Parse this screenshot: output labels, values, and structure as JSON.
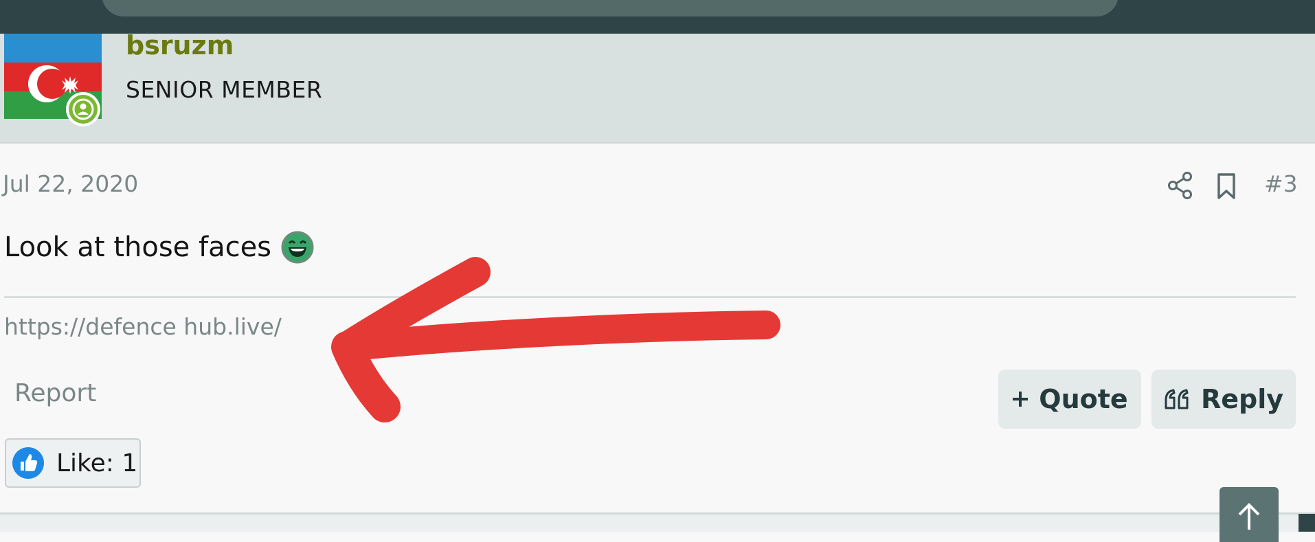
{
  "user": {
    "username": "bsruzm",
    "title": "SENIOR MEMBER",
    "avatar_icon": "azerbaijan-flag-avatar",
    "status_icon": "online-user-icon"
  },
  "post": {
    "date": "Jul 22, 2020",
    "number": "#3",
    "text": "Look at those faces",
    "emoji": "laughing-emoji-icon",
    "signature_link": "https://defence hub.live/"
  },
  "actions": {
    "report_label": "Report",
    "quote_label": "Quote",
    "reply_label": "Reply"
  },
  "reactions": {
    "like_label": "Like: 1"
  },
  "colors": {
    "header": "#2e4447",
    "user_panel": "#d8e1e0",
    "username": "#6b7a10",
    "annotation_arrow": "#e53935"
  }
}
